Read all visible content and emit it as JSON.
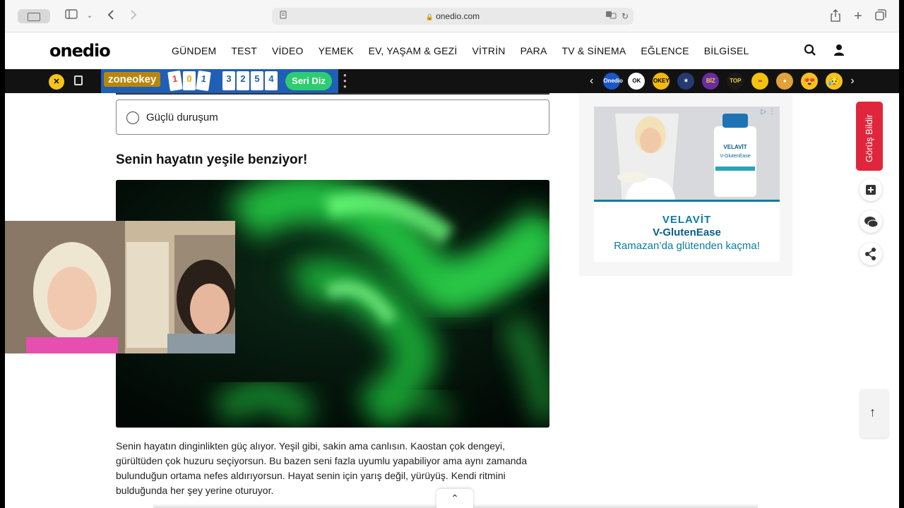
{
  "browser": {
    "url": "onedio.com"
  },
  "site": {
    "logo": "onedio",
    "nav": [
      "GÜNDEM",
      "TEST",
      "VİDEO",
      "YEMEK",
      "EV, YAŞAM & GEZİ",
      "VİTRİN",
      "PARA",
      "TV & SİNEMA",
      "EĞLENCE",
      "BİLGİSEL"
    ]
  },
  "gamebar": {
    "zone_label": "zoneokey",
    "okey_tiles": [
      "1",
      "0",
      "1"
    ],
    "number_tiles": [
      "3",
      "2",
      "5",
      "4"
    ],
    "seri_button": "Seri Diz",
    "icons": [
      "onedio-icon",
      "ok-icon",
      "okey-icon",
      "star-icon",
      "biz-pop-icon",
      "toplist-icon",
      "mask-icon",
      "face-icon",
      "heart-eyes-icon",
      "sad-face-icon"
    ],
    "icon_texts": [
      "Onedio",
      "OK",
      "OKEY",
      "",
      "BİZ POP",
      "TOP",
      "",
      "",
      "",
      ""
    ]
  },
  "quiz": {
    "option_label": "Güçlü duruşum",
    "result_title": "Senin hayatın yeşile benziyor!",
    "result_text": "Senin hayatın dinginlikten güç alıyor. Yeşil gibi, sakin ama canlısın. Kaostan çok dengeyi, gürültüden çok huzuru seçiyorsun. Bu bazen seni fazla uyumlu yapabiliyor ama aynı zamanda bulunduğun ortama nefes aldırıyorsun. Hayat senin için yarış değil, yürüyüş. Kendi ritmini bulduğunda her şey yerine oturuyor."
  },
  "ad": {
    "brand": "VELAVİT",
    "product": "V-GlutenEase",
    "slogan": "Ramazan’da glütenden kaçma!",
    "bottle_brand": "VELAVİT",
    "bottle_product": "V-GlutenEase"
  },
  "sidebar": {
    "feedback_label": "Görüş Bildir"
  },
  "colors": {
    "accent_red": "#e0263c",
    "zone_blue": "#1f5fb6",
    "seri_green": "#2ecc71",
    "ad_teal": "#0a7da0"
  }
}
